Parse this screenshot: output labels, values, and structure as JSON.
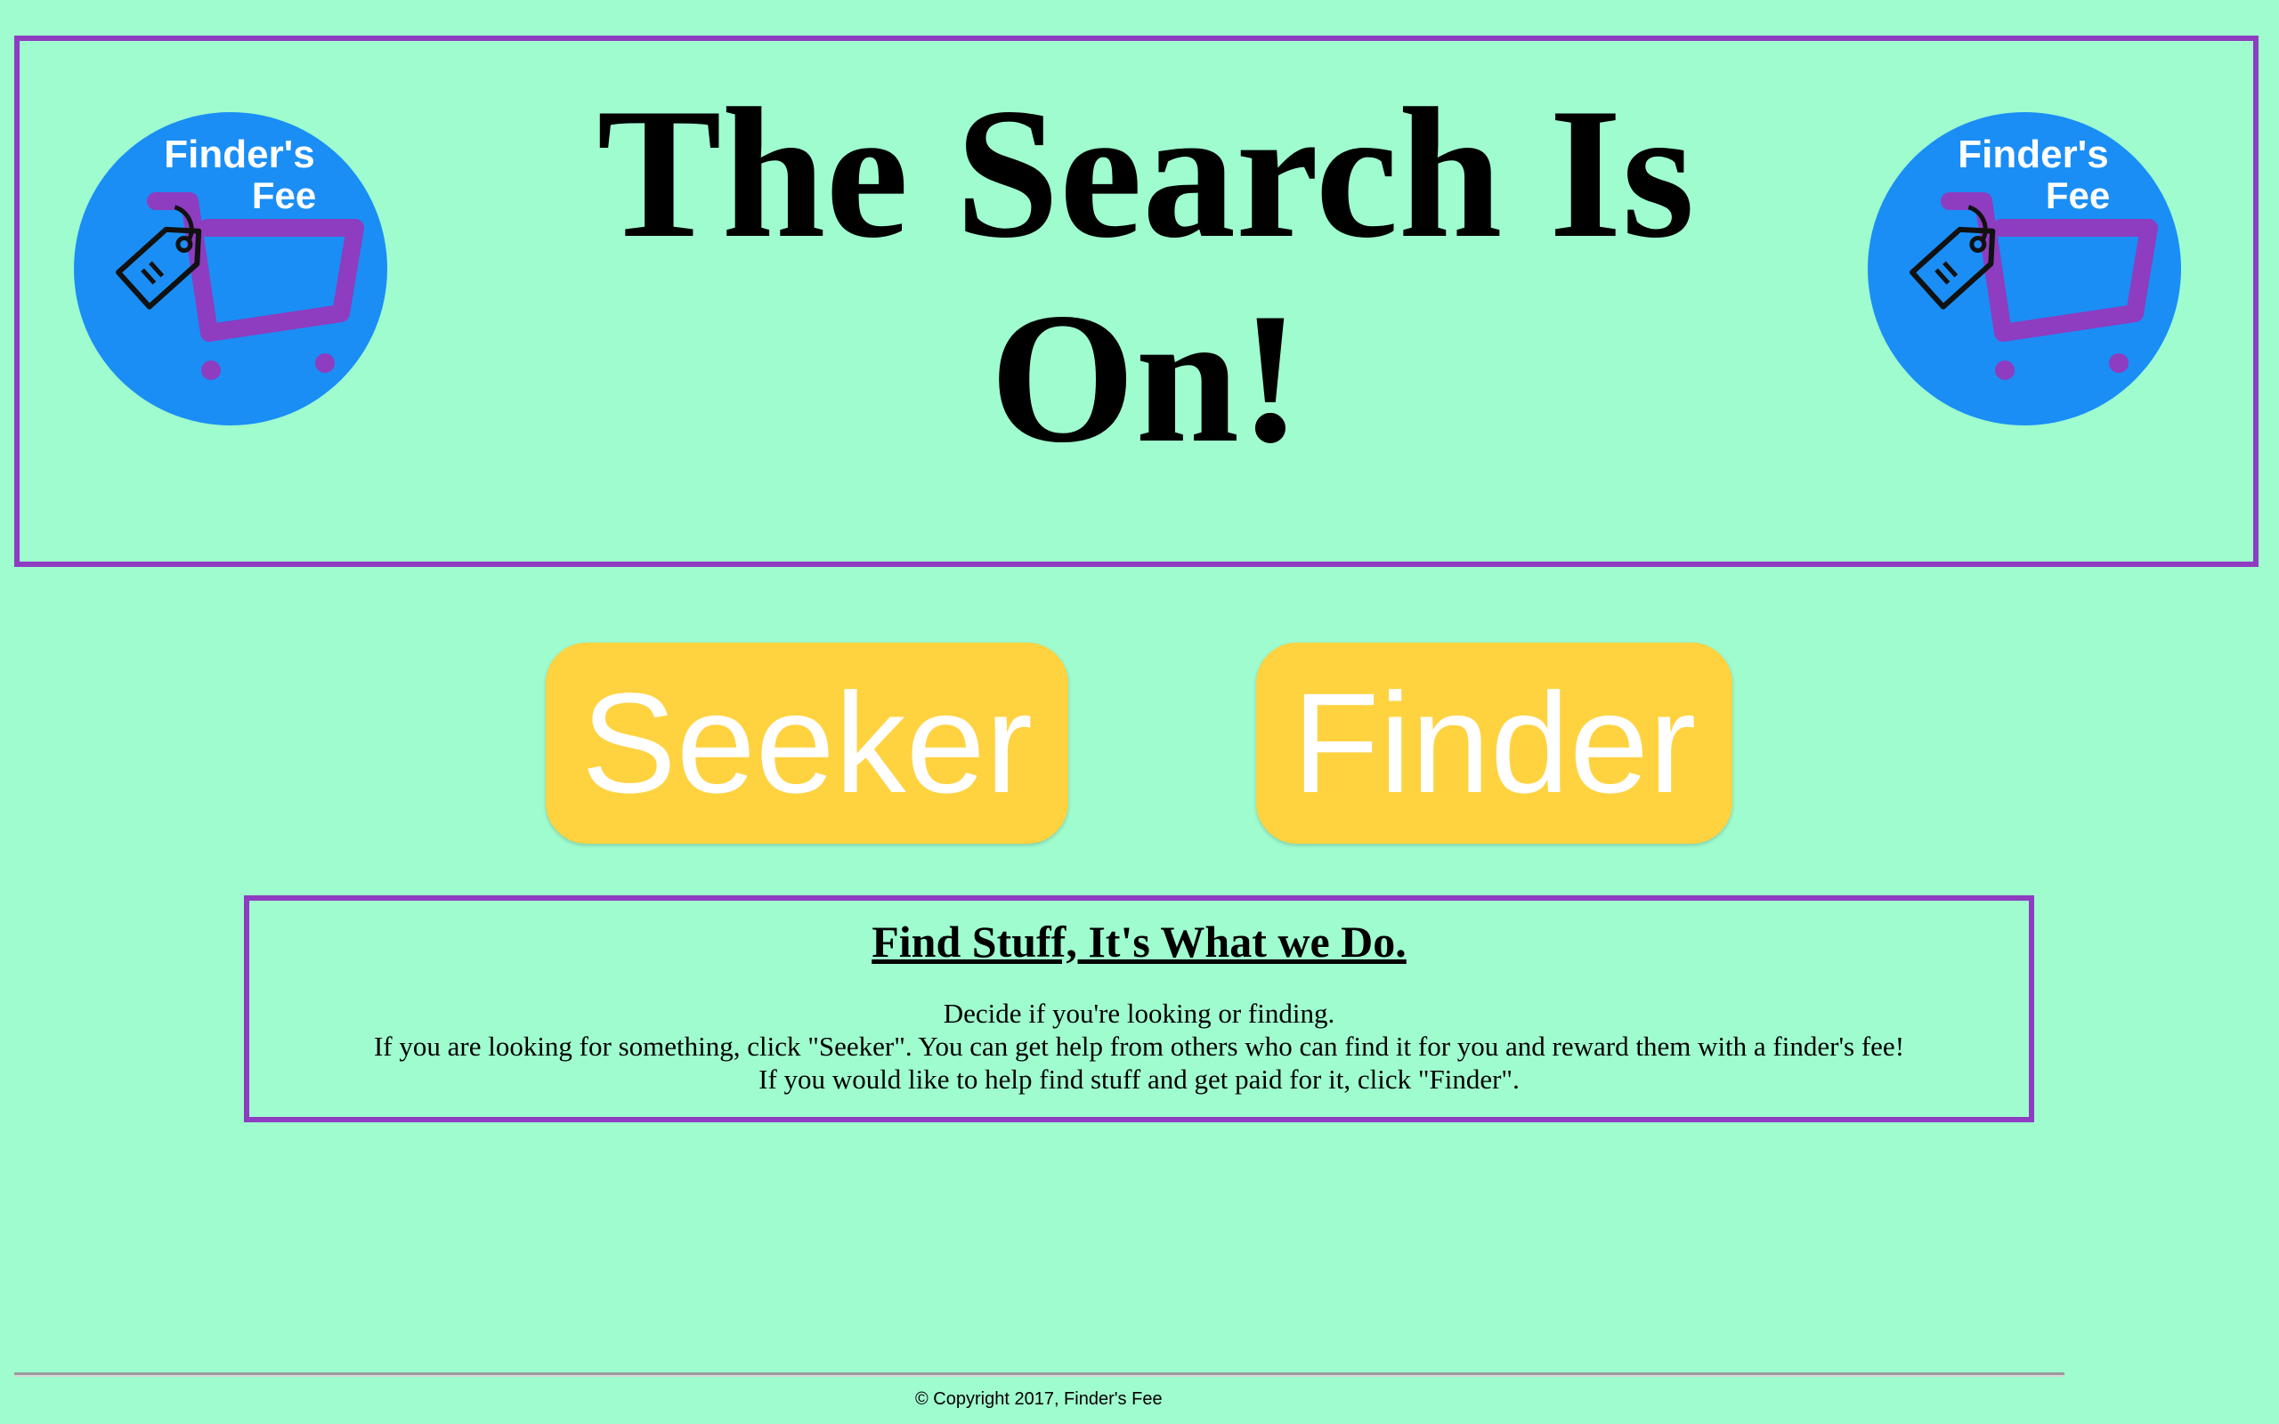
{
  "header": {
    "title": "The Search Is On!",
    "logo_text_line1": "Finder's",
    "logo_text_line2": "Fee"
  },
  "buttons": {
    "seeker_label": "Seeker",
    "finder_label": "Finder"
  },
  "info": {
    "heading": "Find Stuff, It's What we Do.",
    "lines": [
      "Decide if you're looking or finding.",
      "If you are looking for something, click \"Seeker\". You can get help from others who can find it for you and reward them with a finder's fee!",
      "If you would like to help find stuff and get paid for it, click \"Finder\"."
    ]
  },
  "footer": {
    "copyright": "© Copyright 2017, Finder's Fee"
  },
  "colors": {
    "background": "#9ffccf",
    "border": "#8e3cc0",
    "button": "#ffd240",
    "logo_blue": "#1a8ef5",
    "cart_purple": "#8e3cc0"
  },
  "icons": {
    "logo": "shopping-cart-with-price-tag-logo"
  }
}
